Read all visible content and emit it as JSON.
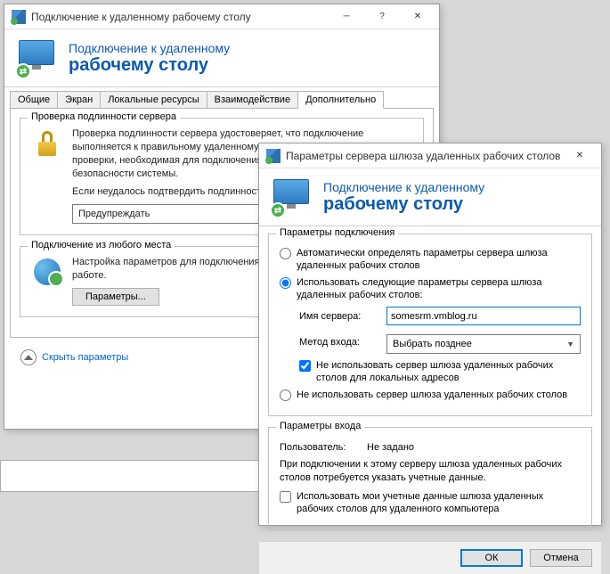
{
  "main_window": {
    "title": "Подключение к удаленному рабочему столу",
    "header_line1": "Подключение к удаленному",
    "header_line2": "рабочему столу",
    "tabs": [
      "Общие",
      "Экран",
      "Локальные ресурсы",
      "Взаимодействие",
      "Дополнительно"
    ],
    "active_tab_index": 4,
    "groupbox1": {
      "legend": "Проверка подлинности сервера",
      "para1": "Проверка подлинности сервера удостоверяет, что подключение выполняется к правильному удаленному компьютеру. Строгость проверки, необходимая для подключения, определяется политикой безопасности системы.",
      "para2": "Если неудалось подтвердить подлинность удаленного компьютера:",
      "dropdown_value": "Предупреждать"
    },
    "groupbox2": {
      "legend": "Подключение из любого места",
      "para": "Настройка параметров для подключения через шлюз при удаленной работе.",
      "button": "Параметры..."
    },
    "footer_link": "Скрыть параметры"
  },
  "sub_window": {
    "title": "Параметры сервера шлюза удаленных рабочих столов",
    "header_line1": "Подключение к удаленному",
    "header_line2": "рабочему столу",
    "group_conn": {
      "legend": "Параметры подключения",
      "radio1": "Автоматически определять параметры сервера шлюза удаленных рабочих столов",
      "radio2": "Использовать следующие параметры сервера шлюза удаленных рабочих столов:",
      "server_label": "Имя сервера:",
      "server_value": "somesrm.vmblog.ru",
      "method_label": "Метод входа:",
      "method_value": "Выбрать позднее",
      "check1": "Не использовать сервер шлюза удаленных рабочих столов для локальных адресов",
      "radio3": "Не использовать сервер шлюза удаленных рабочих столов"
    },
    "group_login": {
      "legend": "Параметры входа",
      "user_label": "Пользователь:",
      "user_value": "Не задано",
      "para": "При подключении к этому серверу шлюза удаленных рабочих столов потребуется указать учетные данные.",
      "check": "Использовать мои учетные данные шлюза удаленных рабочих столов для удаленного компьютера"
    },
    "ok": "ОК",
    "cancel": "Отмена"
  }
}
